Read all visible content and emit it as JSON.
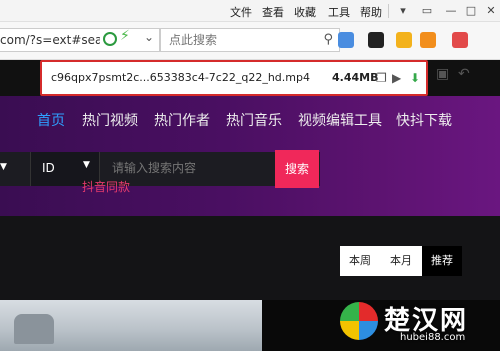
{
  "menubar": {
    "items": [
      "文件",
      "查看",
      "收藏",
      "工具",
      "帮助"
    ]
  },
  "address": {
    "url_visible": "com/?s=ext#sea",
    "search_placeholder": "点此搜索"
  },
  "download": {
    "filename": "c96qpx7psmt2c...653383c4-7c22_q22_hd.mp4",
    "size": "4.44MB"
  },
  "nav": {
    "items": [
      "首页",
      "热门视频",
      "热门作者",
      "热门音乐",
      "视频编辑工具",
      "快抖下载"
    ]
  },
  "search": {
    "type_selected": "ID",
    "placeholder": "请输入搜索内容",
    "button": "搜索",
    "tagline": "抖音同款"
  },
  "period": {
    "items": [
      "本周",
      "本月",
      "推荐"
    ],
    "active": "推荐"
  },
  "watermark": {
    "title": "楚汉网",
    "domain": "hubei88.com"
  },
  "colors": {
    "accent_nav": "#2ea0ff",
    "search_button": "#f0285a",
    "download_border": "#d52b2b",
    "hero_start": "#3a0d52",
    "hero_end": "#6a1680"
  }
}
